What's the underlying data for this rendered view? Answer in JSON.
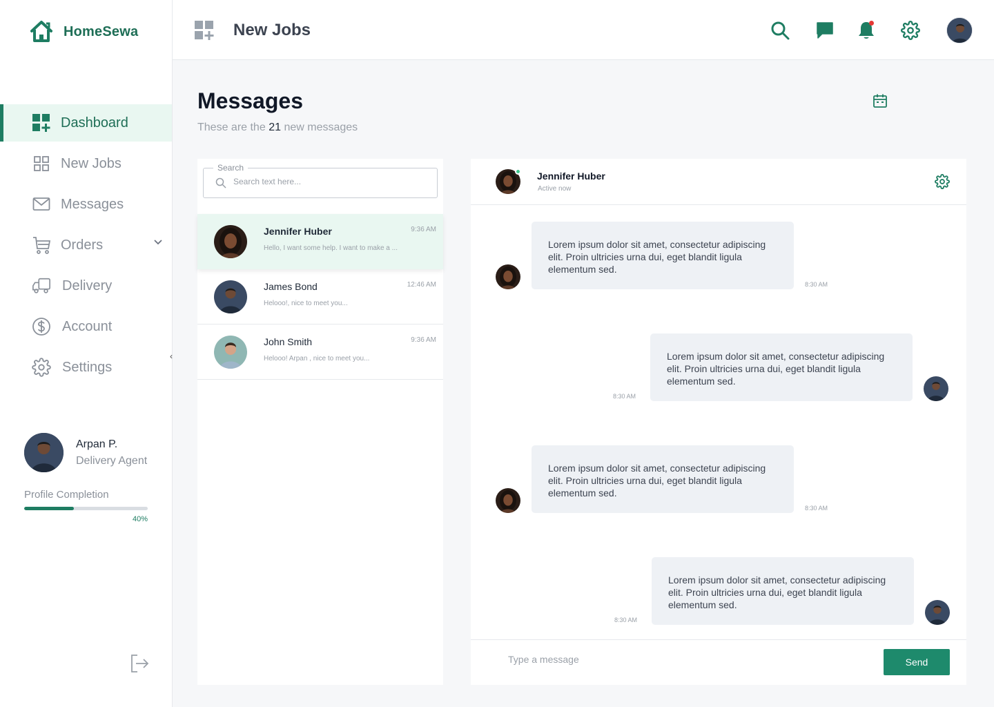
{
  "brand": {
    "name": "HomeSewa"
  },
  "colors": {
    "accent": "#1e7d62",
    "accent_light": "#e9f7f1",
    "notification_dot": "#e53935",
    "online": "#3ec78d"
  },
  "sidebar": {
    "items": [
      {
        "label": "Dashboard",
        "icon": "dashboard-icon",
        "active": true
      },
      {
        "label": "New Jobs",
        "icon": "grid-icon"
      },
      {
        "label": "Messages",
        "icon": "envelope-icon"
      },
      {
        "label": "Orders",
        "icon": "cart-icon"
      },
      {
        "label": "Delivery",
        "icon": "truck-icon"
      },
      {
        "label": "Account",
        "icon": "dollar-icon"
      },
      {
        "label": "Settings",
        "icon": "gear-icon"
      }
    ],
    "profile": {
      "name": "Arpan P.",
      "role": "Delivery Agent"
    },
    "completion": {
      "label": "Profile Completion",
      "percent_text": "40%",
      "value": 0.4
    }
  },
  "topbar": {
    "title": "New Jobs"
  },
  "main": {
    "heading": "Messages",
    "sub_prefix": "These are the",
    "sub_count": "21",
    "sub_suffix": "new messages"
  },
  "search": {
    "legend": "Search",
    "placeholder": "Search text here..."
  },
  "conversations": [
    {
      "name": "Jennifer Huber",
      "preview": "Hello, I want some help. I want to make a ...",
      "time": "9:36 AM",
      "active": true
    },
    {
      "name": "James Bond",
      "preview": "Helooo!, nice to meet you...",
      "time": "12:46 AM"
    },
    {
      "name": "John Smith",
      "preview": "Helooo! Arpan , nice to meet you...",
      "time": "9:36 AM"
    }
  ],
  "chat": {
    "name": "Jennifer Huber",
    "status": "Active now",
    "messages": [
      {
        "text": "Lorem ipsum dolor sit amet, consectetur adipiscing elit. Proin ultricies urna dui, eget blandit ligula elementum sed.",
        "time": "8:30 AM",
        "from": "them"
      },
      {
        "text": "Lorem ipsum dolor sit amet, consectetur adipiscing elit. Proin ultricies urna dui, eget blandit ligula elementum sed.",
        "time": "8:30 AM",
        "from": "me"
      },
      {
        "text": "Lorem ipsum dolor sit amet, consectetur adipiscing elit. Proin ultricies urna dui, eget blandit ligula elementum sed.",
        "time": "8:30 AM",
        "from": "them"
      },
      {
        "text": "Lorem ipsum dolor sit amet, consectetur adipiscing elit. Proin ultricies urna dui, eget blandit ligula elementum sed.",
        "time": "8:30 AM",
        "from": "me"
      }
    ],
    "composer_placeholder": "Type a message",
    "send_label": "Send"
  }
}
